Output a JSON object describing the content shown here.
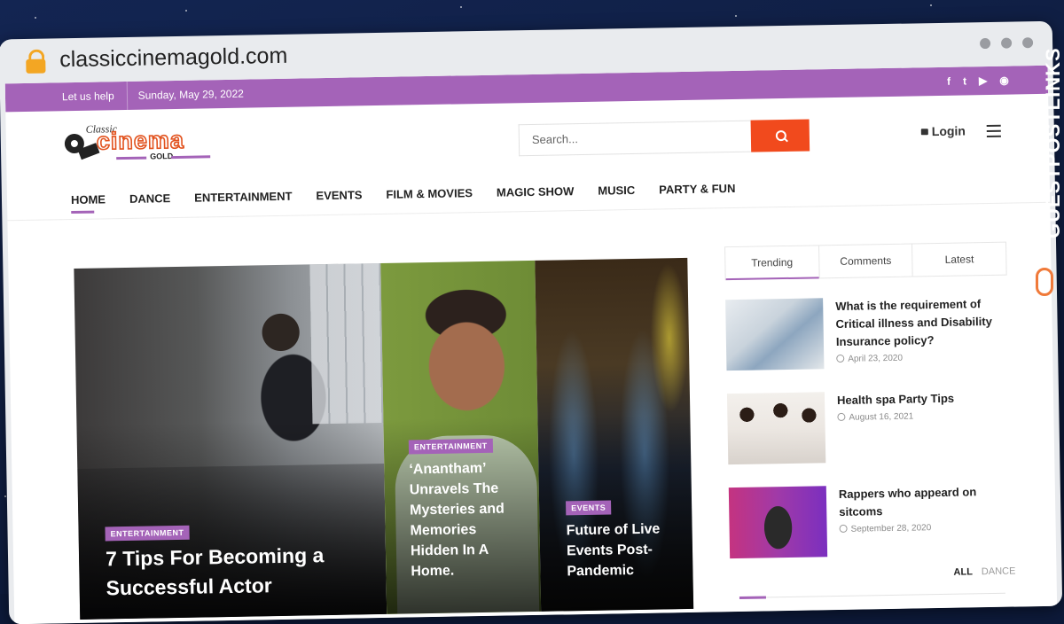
{
  "browser": {
    "url": "classiccinemagold.com"
  },
  "topbar": {
    "help": "Let us help",
    "date": "Sunday, May 29, 2022",
    "social": [
      "f",
      "t",
      "yt",
      "rss"
    ]
  },
  "header": {
    "logo": {
      "classic": "Classic",
      "cinema": "cinema",
      "gold": "GOLD"
    },
    "search_placeholder": "Search...",
    "login": "Login"
  },
  "nav": [
    "HOME",
    "DANCE",
    "ENTERTAINMENT",
    "EVENTS",
    "FILM & MOVIES",
    "MAGIC SHOW",
    "MUSIC",
    "PARTY & FUN"
  ],
  "hero": [
    {
      "badge": "ENTERTAINMENT",
      "title": "7 Tips For Becoming a Successful Actor"
    },
    {
      "badge": "ENTERTAINMENT",
      "title": "‘Anantham’ Unravels The Mysteries and Memories Hidden In A Home."
    },
    {
      "badge": "EVENTS",
      "title": "Future of Live Events Post-Pandemic"
    }
  ],
  "sidebar": {
    "tabs": [
      "Trending",
      "Comments",
      "Latest"
    ],
    "posts": [
      {
        "title": "What is the requirement of Critical illness and Disability Insurance policy?",
        "date": "April 23, 2020"
      },
      {
        "title": "Health spa Party Tips",
        "date": "August 16, 2021"
      },
      {
        "title": "Rappers who appeard on sitcoms",
        "date": "September 28, 2020"
      }
    ],
    "filters": [
      "ALL",
      "DANCE"
    ]
  },
  "watermark": {
    "text_a": "GUESTPOST",
    "text_b": "LINKS"
  }
}
